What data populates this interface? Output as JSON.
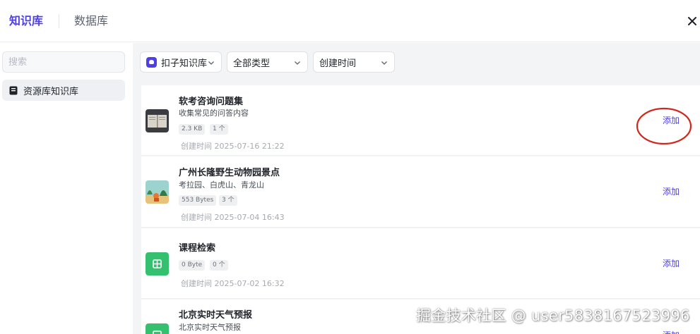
{
  "header": {
    "tabs": [
      {
        "label": "知识库",
        "active": true
      },
      {
        "label": "数据库",
        "active": false
      }
    ]
  },
  "sidebar": {
    "search_placeholder": "搜索",
    "items": [
      {
        "label": "资源库知识库",
        "icon": "book-icon",
        "selected": true
      }
    ]
  },
  "filters": {
    "source": {
      "label": "扣子知识库",
      "icon": "coze-icon"
    },
    "type": {
      "label": "全部类型"
    },
    "time": {
      "label": "创建时间"
    }
  },
  "cards": [
    {
      "title": "软考咨询问题集",
      "desc": "收集常见的问答内容",
      "size": "2.3 KB",
      "count": "1 个",
      "time": "创建时间  2025-07-16 21:22",
      "add_label": "添加",
      "icon": "book-thumbnail-icon"
    },
    {
      "title": "广州长隆野生动物园景点",
      "desc": "考拉园、白虎山、青龙山",
      "size": "553 Bytes",
      "count": "3 个",
      "time": "创建时间  2025-07-04 16:43",
      "add_label": "添加",
      "icon": "zoo-thumbnail-icon"
    },
    {
      "title": "课程检索",
      "desc": "",
      "size": "0 Byte",
      "count": "0 个",
      "time": "创建时间  2025-07-02 16:32",
      "add_label": "添加",
      "icon": "table-icon"
    },
    {
      "title": "北京实时天气预报",
      "desc": "北京实时天气预报",
      "size": "",
      "count": "",
      "time": "",
      "add_label": "添加",
      "icon": "table-icon"
    }
  ],
  "watermark": "掘金技术社区 @ user5838167523996",
  "colors": {
    "accent": "#4e40e5",
    "table_icon": "#34c06f",
    "annotation": "#d0281c"
  }
}
